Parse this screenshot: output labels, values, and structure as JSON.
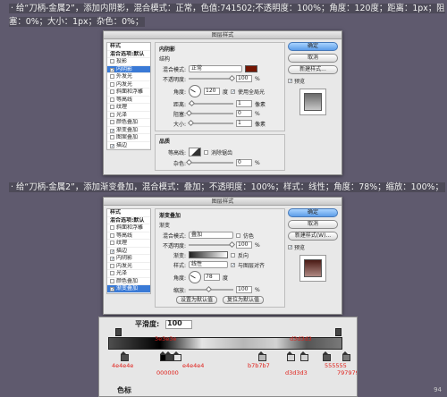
{
  "notes": {
    "note1": "· 给“刀柄-金属2”，添加内阴影，混合模式：正常，色值:741502;不透明度：100%；角度：120度；距离：1px；阻塞：0%；大小：1px；杂色：0%；",
    "note2": "· 给“刀柄-金属2”，添加渐变叠加，混合模式：叠加；不透明度：100%；样式：线性；角度：78%；缩放：100%；"
  },
  "dialog1": {
    "title": "图层样式",
    "left_items": [
      {
        "label": "样式",
        "header": true
      },
      {
        "label": "混合选项:默认",
        "header": true
      },
      {
        "label": "投影",
        "checked": false
      },
      {
        "label": "内阴影",
        "checked": true,
        "selected": true
      },
      {
        "label": "外发光",
        "checked": false
      },
      {
        "label": "内发光",
        "checked": false
      },
      {
        "label": "斜面和浮雕",
        "checked": false
      },
      {
        "label": "等高线",
        "checked": false
      },
      {
        "label": "纹理",
        "checked": false
      },
      {
        "label": "光泽",
        "checked": false
      },
      {
        "label": "颜色叠加",
        "checked": false
      },
      {
        "label": "渐变叠加",
        "checked": true
      },
      {
        "label": "图案叠加",
        "checked": false
      },
      {
        "label": "描边",
        "checked": true
      }
    ],
    "group_title": "内阴影",
    "sub_title": "结构",
    "blend_label": "混合模式:",
    "blend_value": "正常",
    "opacity_label": "不透明度:",
    "opacity_value": "100",
    "angle_label": "角度:",
    "angle_value": "120",
    "angle_unit": "度",
    "global_light": "使用全局光",
    "distance_label": "距离:",
    "distance_value": "1",
    "choke_label": "阻塞:",
    "choke_value": "0",
    "size_label": "大小:",
    "size_value": "1",
    "px": "像素",
    "pct": "%",
    "quality_title": "品质",
    "contour_label": "等高线:",
    "antialias": "消除锯齿",
    "noise_label": "杂色:",
    "noise_value": "0",
    "buttons": {
      "ok": "确定",
      "cancel": "取消",
      "new_style": "新建样式...",
      "preview": "预览"
    },
    "shadow_color": "#741502"
  },
  "dialog2": {
    "title": "图层样式",
    "left_items": [
      {
        "label": "样式",
        "header": true
      },
      {
        "label": "混合选项:默认",
        "header": true
      },
      {
        "label": "斜面和浮雕",
        "checked": false
      },
      {
        "label": "等高线",
        "checked": false
      },
      {
        "label": "纹理",
        "checked": false
      },
      {
        "label": "描边",
        "checked": true
      },
      {
        "label": "内阴影",
        "checked": true
      },
      {
        "label": "内发光",
        "checked": false
      },
      {
        "label": "光泽",
        "checked": false
      },
      {
        "label": "颜色叠加",
        "checked": false
      },
      {
        "label": "渐变叠加",
        "checked": true,
        "selected": true
      }
    ],
    "group_title": "渐变叠加",
    "sub_title": "渐变",
    "blend_label": "混合模式:",
    "blend_value": "叠加",
    "dither": "仿色",
    "opacity_label": "不透明度:",
    "opacity_value": "100",
    "gradient_label": "渐变:",
    "reverse": "反向",
    "style_label": "样式:",
    "style_value": "线性",
    "align": "与图层对齐",
    "angle_label": "角度:",
    "angle_value": "78",
    "angle_unit": "度",
    "scale_label": "缩放:",
    "scale_value": "100",
    "pct": "%",
    "default_btn": "设置为默认值",
    "reset_btn": "复位为默认值",
    "buttons": {
      "ok": "确定",
      "cancel": "取消",
      "new_style": "新建样式(W)...",
      "preview": "预览"
    }
  },
  "gradient_editor": {
    "smooth_label": "平滑度:",
    "smooth_value": "100",
    "color_label": "色标",
    "stops": [
      {
        "label": "4e4e4e",
        "color": "#4e4e4e"
      },
      {
        "label": "000000",
        "color": "#000000"
      },
      {
        "label": "e4e4e4",
        "color": "#e4e4e4"
      },
      {
        "label": "3e3e3e",
        "color": "#3e3e3e"
      },
      {
        "label": "b7b7b7",
        "color": "#b7b7b7"
      },
      {
        "label": "d3d3d3",
        "color": "#d3d3d3"
      },
      {
        "label": "555555",
        "color": "#555555"
      },
      {
        "label": "d3d3d3",
        "color": "#d3d3d3"
      },
      {
        "label": "797979",
        "color": "#797979"
      }
    ],
    "page_number": "94"
  }
}
